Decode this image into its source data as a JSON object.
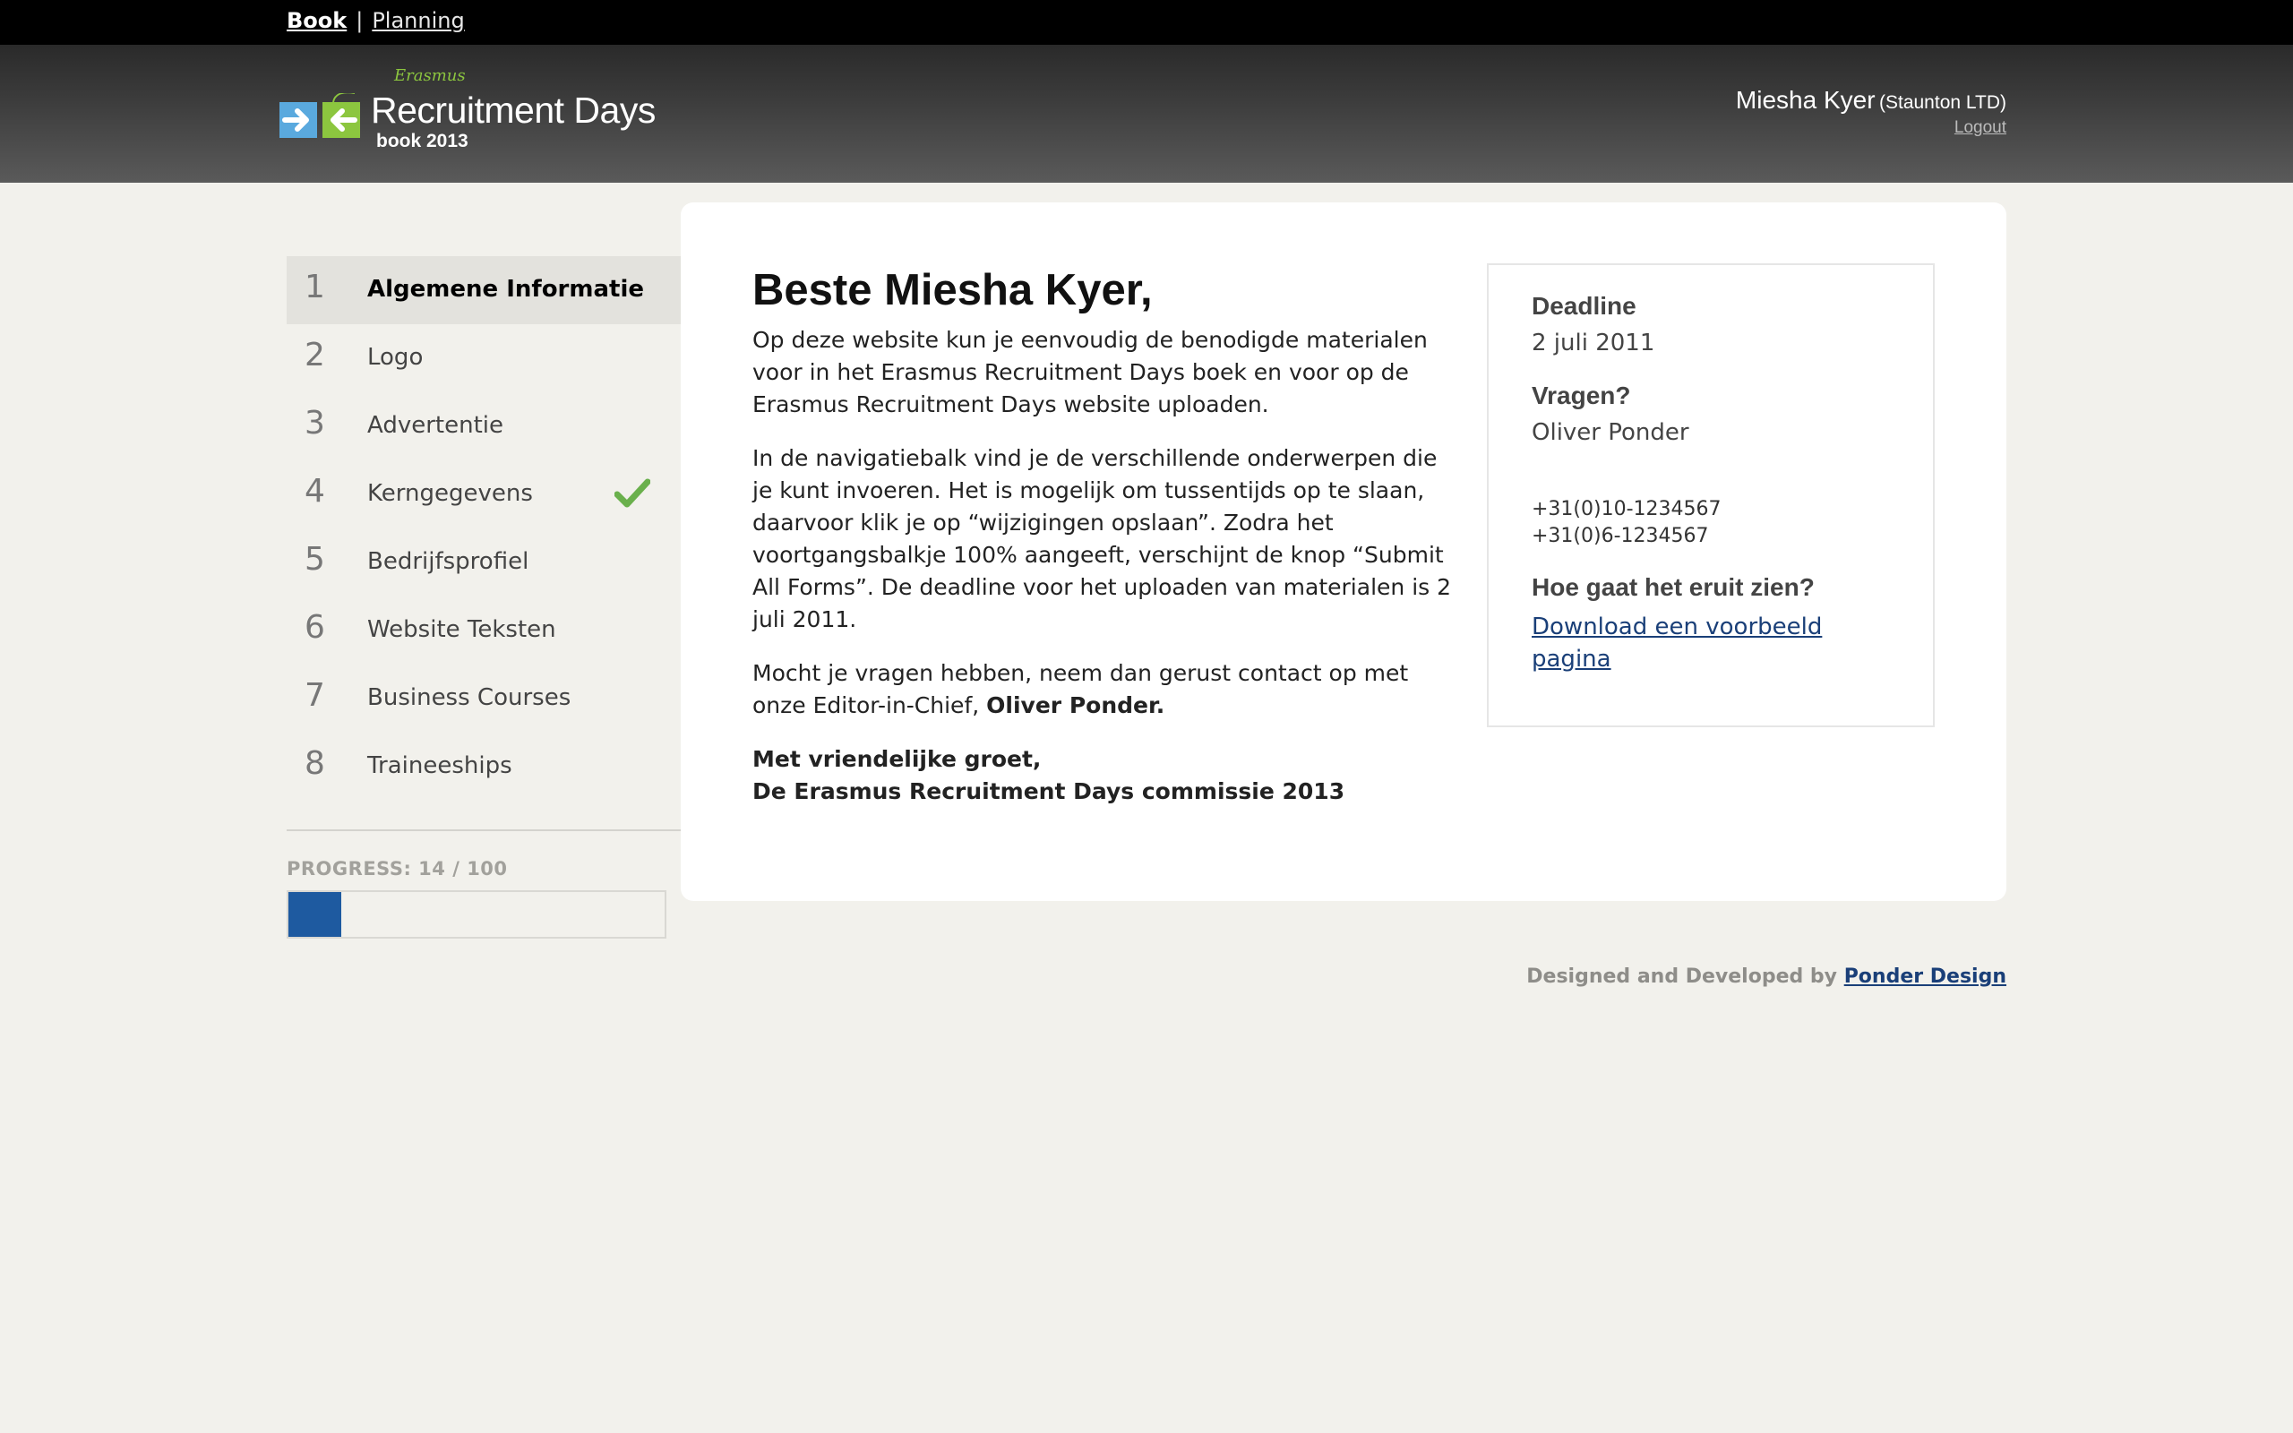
{
  "topnav": {
    "book": "Book",
    "separator": "|",
    "planning": "Planning"
  },
  "header": {
    "logo_brand": "Recruitment Days",
    "logo_sub": "book 2013",
    "logo_script": "Erasmus",
    "user_name": "Miesha Kyer",
    "user_company": "(Staunton LTD)",
    "logout": "Logout"
  },
  "sidebar": {
    "items": [
      {
        "num": "1",
        "label": "Algemene Informatie",
        "active": true,
        "done": false
      },
      {
        "num": "2",
        "label": "Logo",
        "active": false,
        "done": false
      },
      {
        "num": "3",
        "label": "Advertentie",
        "active": false,
        "done": false
      },
      {
        "num": "4",
        "label": "Kerngegevens",
        "active": false,
        "done": true
      },
      {
        "num": "5",
        "label": "Bedrijfsprofiel",
        "active": false,
        "done": false
      },
      {
        "num": "6",
        "label": "Website Teksten",
        "active": false,
        "done": false
      },
      {
        "num": "7",
        "label": "Business Courses",
        "active": false,
        "done": false
      },
      {
        "num": "8",
        "label": "Traineeships",
        "active": false,
        "done": false
      }
    ],
    "progress_label": "PROGRESS: 14 / 100",
    "progress_value": 14,
    "progress_max": 100
  },
  "main": {
    "greeting": "Beste Miesha Kyer,",
    "p1": "Op deze website kun je eenvoudig de benodigde materialen voor in het Erasmus Recruitment Days boek en voor op de Erasmus Recruitment Days website uploaden.",
    "p2": "In de navigatiebalk vind je de verschillende onderwerpen die je kunt invoeren. Het is mogelijk om tussentijds op te slaan, daarvoor klik je op “wijzigingen opslaan”. Zodra het voortgangsbalkje 100% aangeeft, verschijnt de knop “Submit All Forms”. De deadline voor het uploaden van materialen is 2 juli 2011.",
    "p3_text": "Mocht je vragen hebben, neem dan gerust contact op met onze Editor-in-Chief,",
    "p3_name": "Oliver Ponder.",
    "closing_1": "Met vriendelijke groet,",
    "closing_2": "De Erasmus Recruitment Days commissie 2013"
  },
  "infobox": {
    "deadline_heading": "Deadline",
    "deadline_value": "2 juli 2011",
    "questions_heading": "Vragen?",
    "contact_name": "Oliver Ponder",
    "phone_1": "+31(0)10-1234567",
    "phone_2": "+31(0)6-1234567",
    "preview_heading": "Hoe gaat het eruit zien?",
    "download_link": "Download een voorbeeld pagina"
  },
  "footer": {
    "text": "Designed and Developed by",
    "link": "Ponder Design"
  },
  "colors": {
    "progress_fill": "#1e5aa0",
    "link": "#1a3f78",
    "check": "#6ab04c"
  }
}
